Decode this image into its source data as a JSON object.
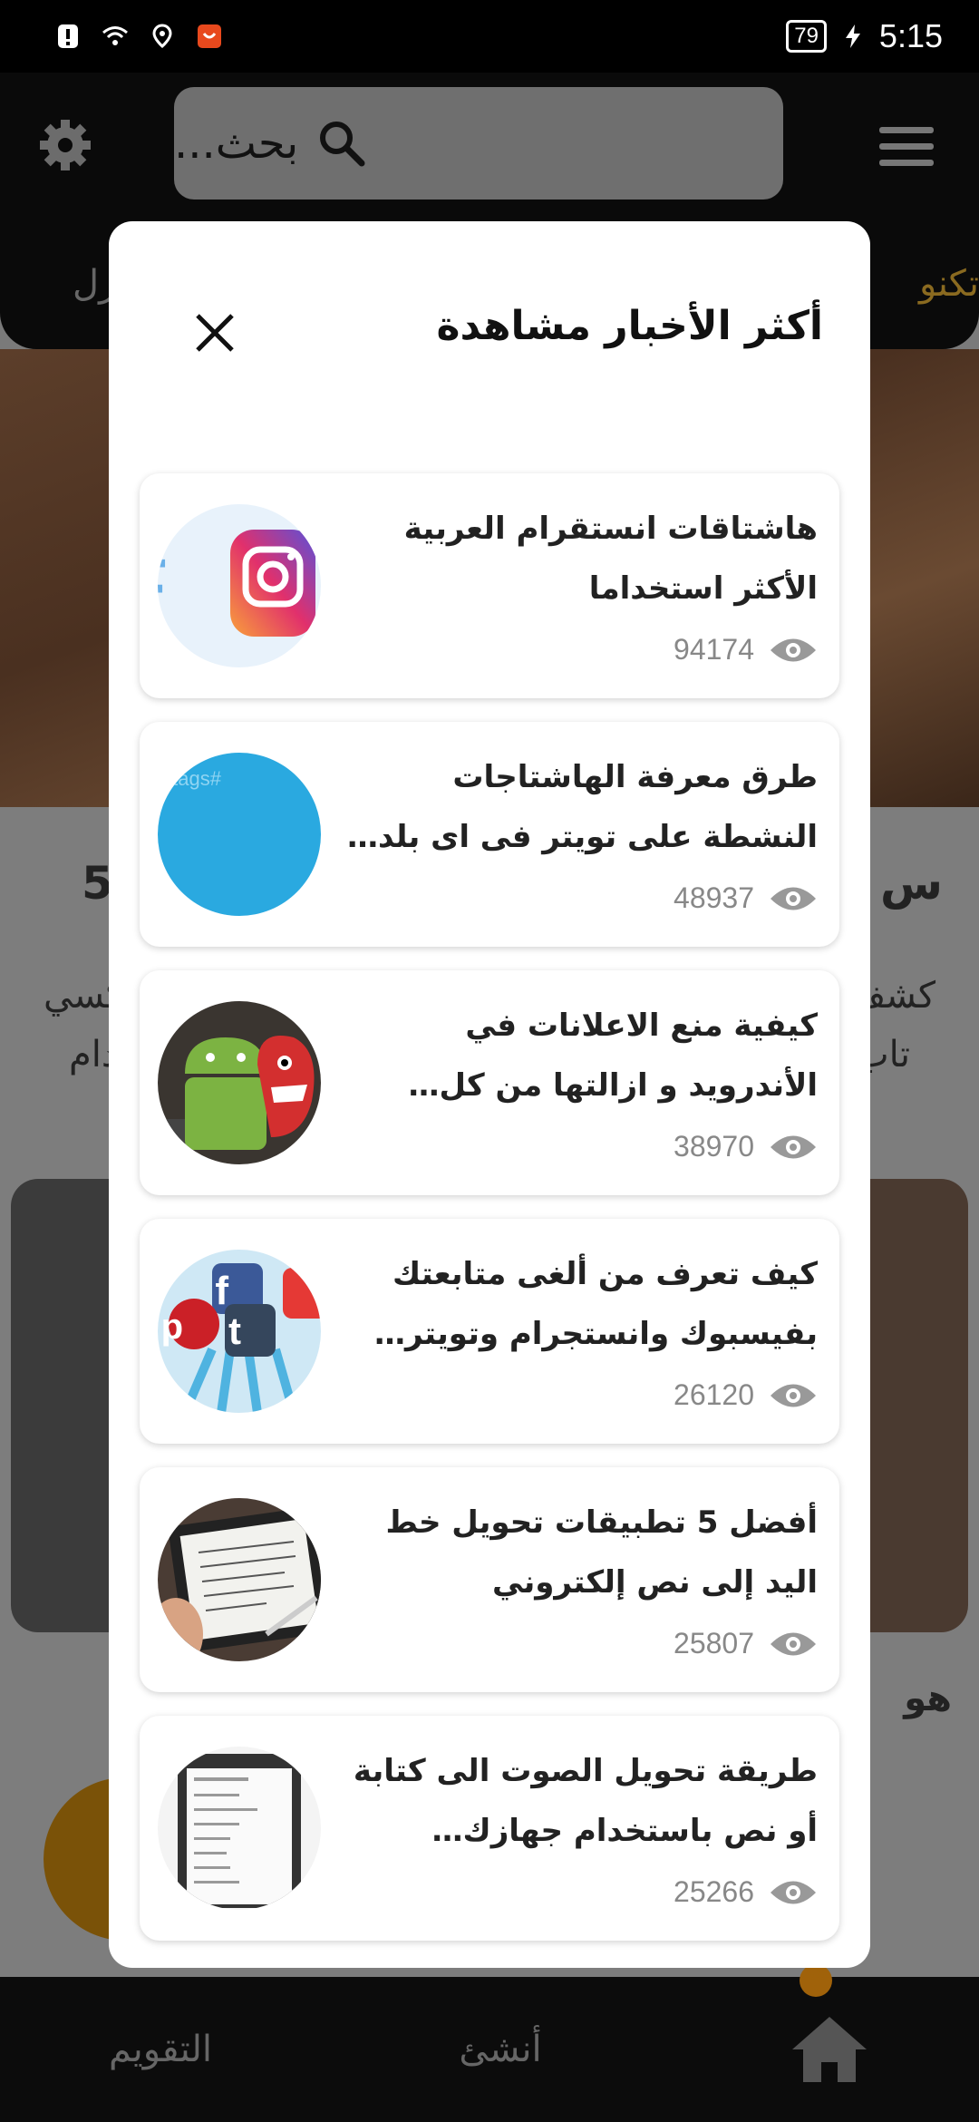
{
  "status_bar": {
    "battery": "79",
    "time": "5:15"
  },
  "header": {
    "search_placeholder": "بحث...",
    "tab_right": "تكنو",
    "tab_left": "زل"
  },
  "background_text": {
    "left_heading": "5",
    "right_heading": "س",
    "line1_right": "كشف",
    "line1_left": "كسي",
    "line2_right": "تاب",
    "line2_left": "دام",
    "card_heading": "هو"
  },
  "modal": {
    "title": "أكثر الأخبار مشاهدة",
    "items": [
      {
        "title": "هاشتاقات انستقرام العربية الأكثر استخداما",
        "views": "94174",
        "thumb": "instagram-hashtag"
      },
      {
        "title": "طرق معرفة الهاشتاجات النشطة على تويتر فى اى بلد على الخريطة",
        "views": "48937",
        "thumb": "hashtags"
      },
      {
        "title": "كيفية منع الاعلانات في الأندرويد و ازالتها من كل التطبيقات",
        "views": "38970",
        "thumb": "android"
      },
      {
        "title": "كيف تعرف من ألغى متابعتك بفيسبوك وانستجرام وتويتر وسنابشا...",
        "views": "26120",
        "thumb": "social-icons"
      },
      {
        "title": "أفضل 5 تطبيقات تحويل خط اليد إلى نص إلكتروني",
        "views": "25807",
        "thumb": "handwriting"
      },
      {
        "title": "طريقة تحويل الصوت الى كتابة أو نص باستخدام جهازك الأندرويد عبر Spee...",
        "views": "25266",
        "thumb": "phone-language"
      }
    ]
  },
  "bottom_nav": {
    "calendar": "التقويم",
    "create": "أنشئ"
  },
  "colors": {
    "accent": "#f39c12",
    "modal_bg": "#ffffff",
    "overlay": "#7a7a7a"
  }
}
